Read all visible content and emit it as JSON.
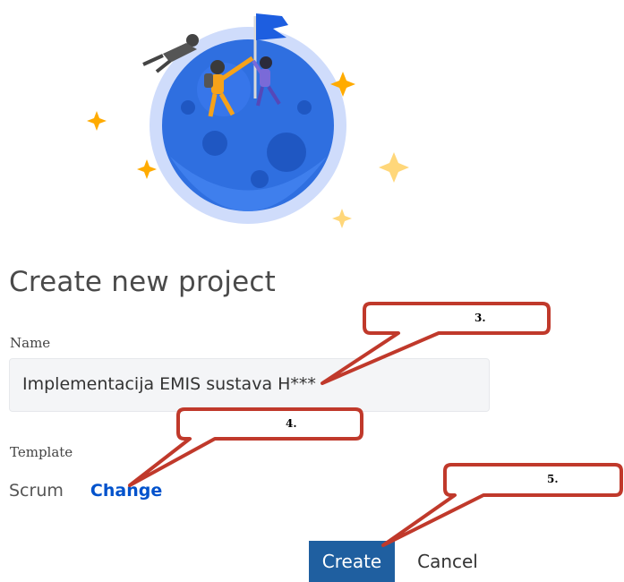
{
  "dialog": {
    "title": "Create new project",
    "name_label": "Name",
    "name_value": "Implementacija EMIS sustava H***",
    "template_label": "Template",
    "template_value": "Scrum",
    "change_link": "Change",
    "create_button": "Create",
    "cancel_button": "Cancel"
  },
  "callouts": [
    {
      "label": "3."
    },
    {
      "label": "4."
    },
    {
      "label": "5."
    }
  ],
  "colors": {
    "primary": "#1f5fa0",
    "link": "#0052cc",
    "callout_border": "#c0392b",
    "planet": "#2f6fe0",
    "star": "#ffab00"
  }
}
